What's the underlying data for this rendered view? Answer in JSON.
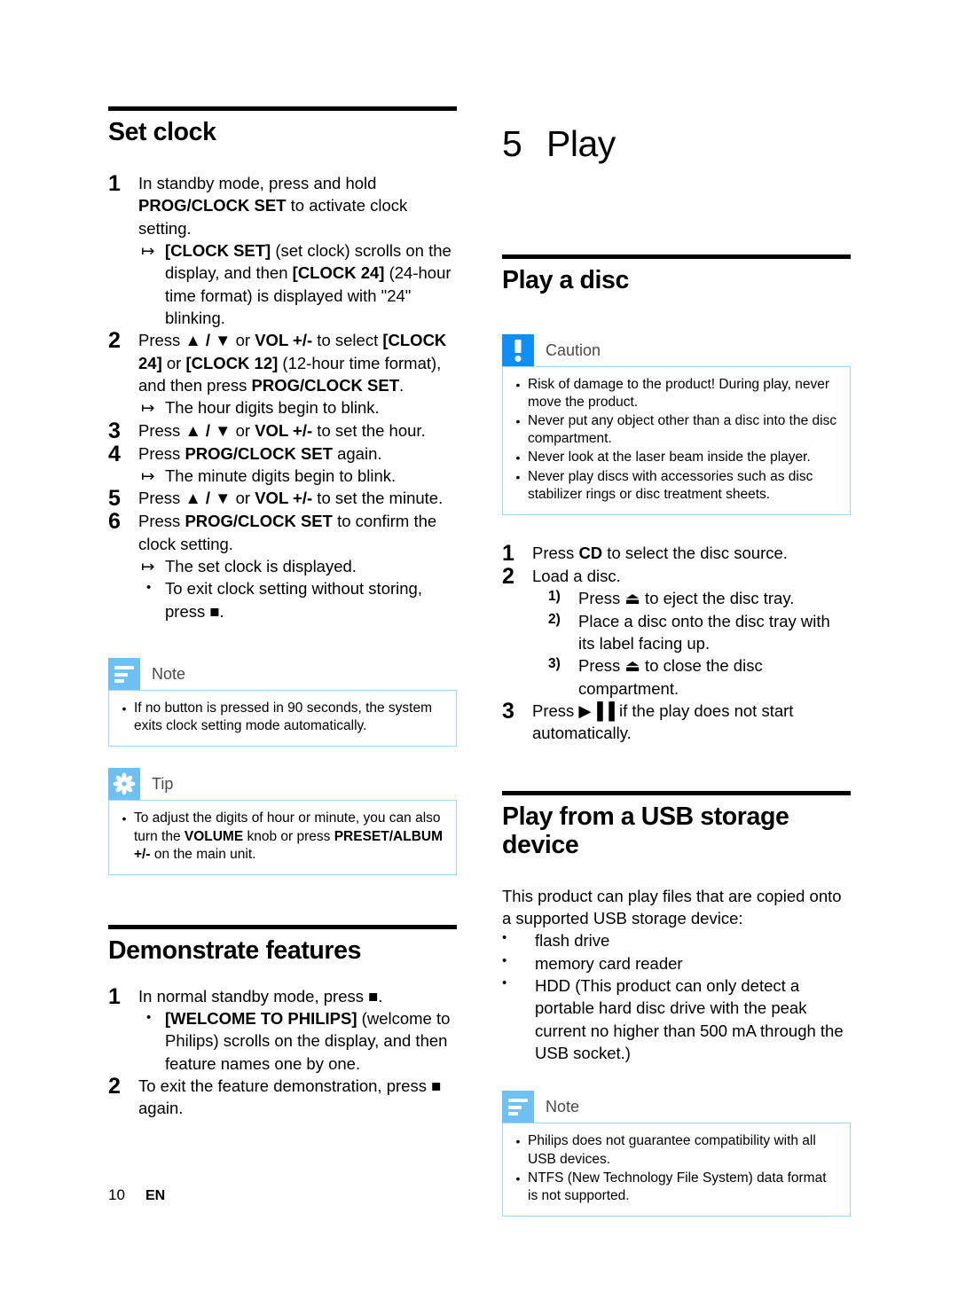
{
  "page": {
    "footer_page_number": "10",
    "footer_language": "EN"
  },
  "colors": {
    "note_icon_blue": "#6dc1f5",
    "caution_icon_blue": "#0d8ff5",
    "callout_border": "#9fd6f7",
    "rule_black": "#000000"
  },
  "left_column": {
    "set_clock": {
      "heading": "Set clock",
      "steps": [
        {
          "num": "1",
          "text_parts": [
            {
              "t": "In standby mode, press and hold ",
              "b": false
            },
            {
              "t": "PROG/CLOCK SET",
              "b": true
            },
            {
              "t": " to activate clock setting.",
              "b": false
            }
          ],
          "sub": [
            {
              "marker": "arrow",
              "parts": [
                {
                  "t": "[CLOCK SET]",
                  "b": true
                },
                {
                  "t": " (set clock) scrolls on the display, and then ",
                  "b": false
                },
                {
                  "t": "[CLOCK 24]",
                  "b": true
                },
                {
                  "t": " (24-hour time format) is displayed with \"24\" blinking.",
                  "b": false
                }
              ]
            }
          ]
        },
        {
          "num": "2",
          "text_parts": [
            {
              "t": "Press ",
              "b": false
            },
            {
              "t": "▲ / ▼",
              "b": true
            },
            {
              "t": " or ",
              "b": false
            },
            {
              "t": "VOL +/-",
              "b": true
            },
            {
              "t": " to select ",
              "b": false
            },
            {
              "t": "[CLOCK 24]",
              "b": true
            },
            {
              "t": " or ",
              "b": false
            },
            {
              "t": "[CLOCK 12]",
              "b": true
            },
            {
              "t": " (12-hour time format), and then press ",
              "b": false
            },
            {
              "t": "PROG/CLOCK SET",
              "b": true
            },
            {
              "t": ".",
              "b": false
            }
          ],
          "sub": [
            {
              "marker": "arrow",
              "parts": [
                {
                  "t": "The hour digits begin to blink.",
                  "b": false
                }
              ]
            }
          ]
        },
        {
          "num": "3",
          "text_parts": [
            {
              "t": "Press ",
              "b": false
            },
            {
              "t": "▲ / ▼",
              "b": true
            },
            {
              "t": " or ",
              "b": false
            },
            {
              "t": "VOL +/-",
              "b": true
            },
            {
              "t": " to set the hour.",
              "b": false
            }
          ],
          "sub": []
        },
        {
          "num": "4",
          "text_parts": [
            {
              "t": "Press ",
              "b": false
            },
            {
              "t": "PROG/CLOCK SET",
              "b": true
            },
            {
              "t": " again.",
              "b": false
            }
          ],
          "sub": [
            {
              "marker": "arrow",
              "parts": [
                {
                  "t": "The minute digits begin to blink.",
                  "b": false
                }
              ]
            }
          ]
        },
        {
          "num": "5",
          "text_parts": [
            {
              "t": "Press ",
              "b": false
            },
            {
              "t": "▲ / ▼",
              "b": true
            },
            {
              "t": " or ",
              "b": false
            },
            {
              "t": "VOL +/-",
              "b": true
            },
            {
              "t": " to set the minute.",
              "b": false
            }
          ],
          "sub": []
        },
        {
          "num": "6",
          "text_parts": [
            {
              "t": "Press ",
              "b": false
            },
            {
              "t": "PROG/CLOCK SET",
              "b": true
            },
            {
              "t": " to confirm the clock setting.",
              "b": false
            }
          ],
          "sub": [
            {
              "marker": "arrow",
              "parts": [
                {
                  "t": "The set clock is displayed.",
                  "b": false
                }
              ]
            },
            {
              "marker": "dot",
              "parts": [
                {
                  "t": "To exit clock setting without storing, press ■.",
                  "b": false
                }
              ]
            }
          ]
        }
      ],
      "note": {
        "icon": "note-icon",
        "label": "Note",
        "items": [
          "If no button is pressed in 90 seconds, the system exits clock setting mode automatically."
        ]
      },
      "tip": {
        "icon": "tip-icon",
        "label": "Tip",
        "items_parts": [
          [
            {
              "t": "To adjust the digits of hour or minute, you can also turn the ",
              "b": false
            },
            {
              "t": "VOLUME",
              "b": true
            },
            {
              "t": " knob or press ",
              "b": false
            },
            {
              "t": "PRESET/ALBUM +/-",
              "b": true
            },
            {
              "t": " on the main unit.",
              "b": false
            }
          ]
        ]
      }
    },
    "demonstrate_features": {
      "heading": "Demonstrate features",
      "steps": [
        {
          "num": "1",
          "text_parts": [
            {
              "t": "In normal standby mode, press ■.",
              "b": false
            }
          ],
          "sub": [
            {
              "marker": "dot",
              "parts": [
                {
                  "t": "[WELCOME TO PHILIPS]",
                  "b": true
                },
                {
                  "t": " (welcome to Philips) scrolls on the display, and then feature names one by one.",
                  "b": false
                }
              ]
            }
          ]
        },
        {
          "num": "2",
          "text_parts": [
            {
              "t": "To exit the feature demonstration, press ■ again.",
              "b": false
            }
          ],
          "sub": []
        }
      ]
    }
  },
  "right_column": {
    "chapter": {
      "number": "5",
      "title": "Play"
    },
    "play_a_disc": {
      "heading": "Play a disc",
      "caution": {
        "icon": "caution-icon",
        "label": "Caution",
        "items": [
          "Risk of damage to the product! During play, never move the product.",
          "Never put any object other than a disc into the disc compartment.",
          "Never look at the laser beam inside the player.",
          "Never play discs with accessories such as disc stabilizer rings or disc treatment sheets."
        ]
      },
      "steps": [
        {
          "num": "1",
          "text_parts": [
            {
              "t": "Press ",
              "b": false
            },
            {
              "t": "CD",
              "b": true
            },
            {
              "t": " to select the disc source.",
              "b": false
            }
          ],
          "sub": []
        },
        {
          "num": "2",
          "text_parts": [
            {
              "t": "Load a disc.",
              "b": false
            }
          ],
          "substeps": [
            {
              "num": "1)",
              "text": "Press ⏏ to eject the disc tray."
            },
            {
              "num": "2)",
              "text": "Place a disc onto the disc tray with its label facing up."
            },
            {
              "num": "3)",
              "text": "Press ⏏ to close the disc compartment."
            }
          ],
          "sub": []
        },
        {
          "num": "3",
          "text_parts": [
            {
              "t": "Press ▶▐▐ if the play does not start automatically.",
              "b": false
            }
          ],
          "sub": []
        }
      ]
    },
    "play_usb": {
      "heading": "Play from a USB storage device",
      "intro": "This product can play files that are copied onto a supported USB storage device:",
      "devices": [
        "flash drive",
        "memory card reader",
        "HDD (This product can only detect a portable hard disc drive with the peak current no higher than 500 mA through the USB socket.)"
      ],
      "note": {
        "icon": "note-icon",
        "label": "Note",
        "items": [
          "Philips does not guarantee compatibility with all USB devices.",
          "NTFS (New Technology File System) data format is not supported."
        ]
      }
    }
  }
}
